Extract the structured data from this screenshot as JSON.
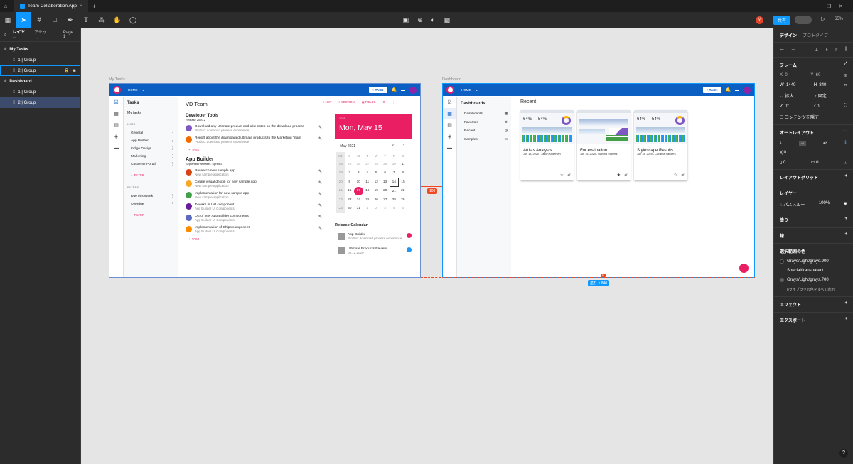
{
  "tabs": {
    "home_icon": "home-icon",
    "doc_title": "Team Collaboration App"
  },
  "toolbar": {
    "share": "共有",
    "zoom": "65%"
  },
  "layers_panel": {
    "tab_layers": "レイヤー",
    "tab_assets": "アセット",
    "page": "Page 1",
    "items": [
      {
        "label": "My Tasks",
        "level": 0,
        "bold": true
      },
      {
        "label": "1 | Group",
        "level": 1
      },
      {
        "label": "2 | Group",
        "level": 1,
        "outlined": true
      },
      {
        "label": "Dashboard",
        "level": 0,
        "bold": true
      },
      {
        "label": "1 | Group",
        "level": 1
      },
      {
        "label": "2 | Group",
        "level": 1,
        "selected": true
      }
    ]
  },
  "canvas": {
    "frame1_label": "My Tasks",
    "frame2_label": "Dashboard",
    "spacing_badge": "100",
    "size_badge": "塗り × 840",
    "gap_badge": "0"
  },
  "mytasks": {
    "home": "HOME",
    "task_btn": "TASK",
    "sidebar_title": "Tasks",
    "my_tasks": "My tasks",
    "lists_header": "LISTS",
    "lists": [
      "General",
      "App Builder",
      "Indigo.Design",
      "Marketing",
      "Customer Portal"
    ],
    "filter": "FILTER",
    "filters_header": "FILTERS",
    "filters": [
      "Due this Week",
      "Overdue"
    ],
    "team": "VD Team",
    "list_btn": "LIST",
    "section_btn": "SECTION",
    "fields_btn": "FIELDS",
    "group1_title": "Developer Tools",
    "group1_sub": "Release 2020.2",
    "group1_tasks": [
      {
        "title": "Download any Ultimate product and take notes on the download process",
        "sub": "Product download process experience"
      },
      {
        "title": "Report about the downloaded ultimate products to the Marketing Team",
        "sub": "Product download process experience"
      }
    ],
    "add_task": "TASK",
    "group2_title": "App Builder",
    "group2_sub": "September release - Sprint 1",
    "group2_tasks": [
      {
        "title": "Research new sample app",
        "sub": "New sample application"
      },
      {
        "title": "Create visual design for new sample app",
        "sub": "New sample application"
      },
      {
        "title": "Implementation for new sample app",
        "sub": "New sample application"
      },
      {
        "title": "Tweaks in List component",
        "sub": "App Builder UI Components"
      },
      {
        "title": "QE of new App Builder components",
        "sub": "App Builder UI Components"
      },
      {
        "title": "Implementation of Chips component",
        "sub": "App Builder UI Components"
      }
    ],
    "date_card_small": "2021",
    "date_card": "Mon, May 15",
    "month": "May 2021",
    "weekdays": [
      "Wk",
      "S",
      "M",
      "T",
      "W",
      "T",
      "F",
      "S"
    ],
    "weeks": [
      [
        "18",
        "25",
        "26",
        "27",
        "28",
        "29",
        "30",
        "1"
      ],
      [
        "19",
        "2",
        "3",
        "4",
        "5",
        "6",
        "7",
        "8"
      ],
      [
        "20",
        "9",
        "10",
        "11",
        "12",
        "13",
        "14",
        "15"
      ],
      [
        "21",
        "16",
        "17",
        "18",
        "19",
        "20",
        "21",
        "22"
      ],
      [
        "22",
        "23",
        "24",
        "25",
        "26",
        "27",
        "28",
        "29"
      ],
      [
        "23",
        "30",
        "31",
        "1",
        "2",
        "3",
        "4",
        "5"
      ]
    ],
    "release_title": "Release Calendar",
    "releases": [
      {
        "title": "App Builder",
        "sub": "Product download process experience"
      },
      {
        "title": "Ultimate Products Review",
        "sub": "08.12.2020"
      }
    ]
  },
  "dashboard": {
    "home": "HOME",
    "task_btn": "TASK",
    "nav_title": "Dashboards",
    "nav": [
      "Dashboards",
      "Favorites",
      "Recent",
      "Samples"
    ],
    "recent": "Recent",
    "cards": [
      {
        "title": "Artists Analysis",
        "sub": "Jun 15, 2020 - Jason Andersen",
        "p1": "64%",
        "p2": "54%"
      },
      {
        "title": "For evaluation",
        "sub": "Jun 15, 2020 - Martina Roberts",
        "p1": "",
        "p2": ""
      },
      {
        "title": "Stylescape Results",
        "sub": "Jun 15, 2020 - Carolina Sanders",
        "p1": "64%",
        "p2": "54%"
      }
    ]
  },
  "design_panel": {
    "tab_design": "デザイン",
    "tab_proto": "プロトタイプ",
    "frame": "フレーム",
    "x_label": "X",
    "x": "0",
    "y_label": "Y",
    "y": "60",
    "w_label": "W",
    "w": "1440",
    "h_label": "H",
    "h": "840",
    "hug": "拡大",
    "fixed": "固定",
    "rot": "0°",
    "radius": "0",
    "clip": "コンテンツを隠す",
    "autolayout": "オートレイアウト",
    "al_gap": "0",
    "al_pad": "0",
    "layout_grid": "レイアウトグリッド",
    "layer": "レイヤー",
    "passthrough": "パススルー",
    "opacity": "100%",
    "fill": "塗り",
    "stroke": "線",
    "selection_colors": "選択範囲の色",
    "colors": [
      {
        "name": "Grays/Light/grays.900",
        "hex": "#1f1f1f"
      },
      {
        "name": "Special/transparent",
        "hex": ""
      },
      {
        "name": "Grays/Light/grays.700",
        "hex": "#5f5f5f"
      }
    ],
    "show_all": "8ライブラリの色をすべて表示",
    "effects": "エフェクト",
    "export": "エクスポート"
  },
  "colors": {
    "accent": "#0d99ff",
    "appbar": "#0b5fc2",
    "pink": "#e91e63"
  }
}
